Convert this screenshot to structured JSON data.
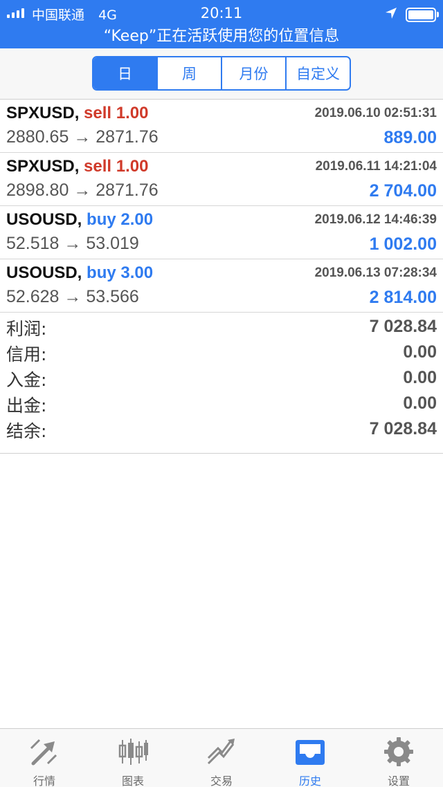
{
  "status_bar": {
    "carrier": "中国联通",
    "network": "4G",
    "time": "20:11",
    "banner": "“Keep”正在活跃使用您的位置信息"
  },
  "period_tabs": [
    {
      "label": "日",
      "active": true
    },
    {
      "label": "周",
      "active": false
    },
    {
      "label": "月份",
      "active": false
    },
    {
      "label": "自定义",
      "active": false
    }
  ],
  "deals": [
    {
      "symbol": "SPXUSD,",
      "action": "sell 1.00",
      "side": "sell",
      "time": "2019.06.10 02:51:31",
      "prices": "2880.65 → 2871.76",
      "profit": "889.00"
    },
    {
      "symbol": "SPXUSD,",
      "action": "sell 1.00",
      "side": "sell",
      "time": "2019.06.11 14:21:04",
      "prices": "2898.80 → 2871.76",
      "profit": "2 704.00"
    },
    {
      "symbol": "USOUSD,",
      "action": "buy 2.00",
      "side": "buy",
      "time": "2019.06.12 14:46:39",
      "prices": "52.518 → 53.019",
      "profit": "1 002.00"
    },
    {
      "symbol": "USOUSD,",
      "action": "buy 3.00",
      "side": "buy",
      "time": "2019.06.13 07:28:34",
      "prices": "52.628 → 53.566",
      "profit": "2 814.00"
    }
  ],
  "summary": [
    {
      "label": "利润:",
      "value": "7 028.84"
    },
    {
      "label": "信用:",
      "value": "0.00"
    },
    {
      "label": "入金:",
      "value": "0.00"
    },
    {
      "label": "出金:",
      "value": "0.00"
    },
    {
      "label": "结余:",
      "value": "7 028.84"
    }
  ],
  "tab_bar": [
    {
      "label": "行情",
      "icon": "quotes-icon",
      "active": false
    },
    {
      "label": "图表",
      "icon": "chart-icon",
      "active": false
    },
    {
      "label": "交易",
      "icon": "trade-icon",
      "active": false
    },
    {
      "label": "历史",
      "icon": "history-icon",
      "active": true
    },
    {
      "label": "设置",
      "icon": "settings-icon",
      "active": false
    }
  ],
  "colors": {
    "accent": "#2f7bf0",
    "sell": "#d03a2a",
    "buy": "#2f7bf0",
    "profit": "#2f7bf0",
    "inactive_icon": "#8a8a8a"
  }
}
